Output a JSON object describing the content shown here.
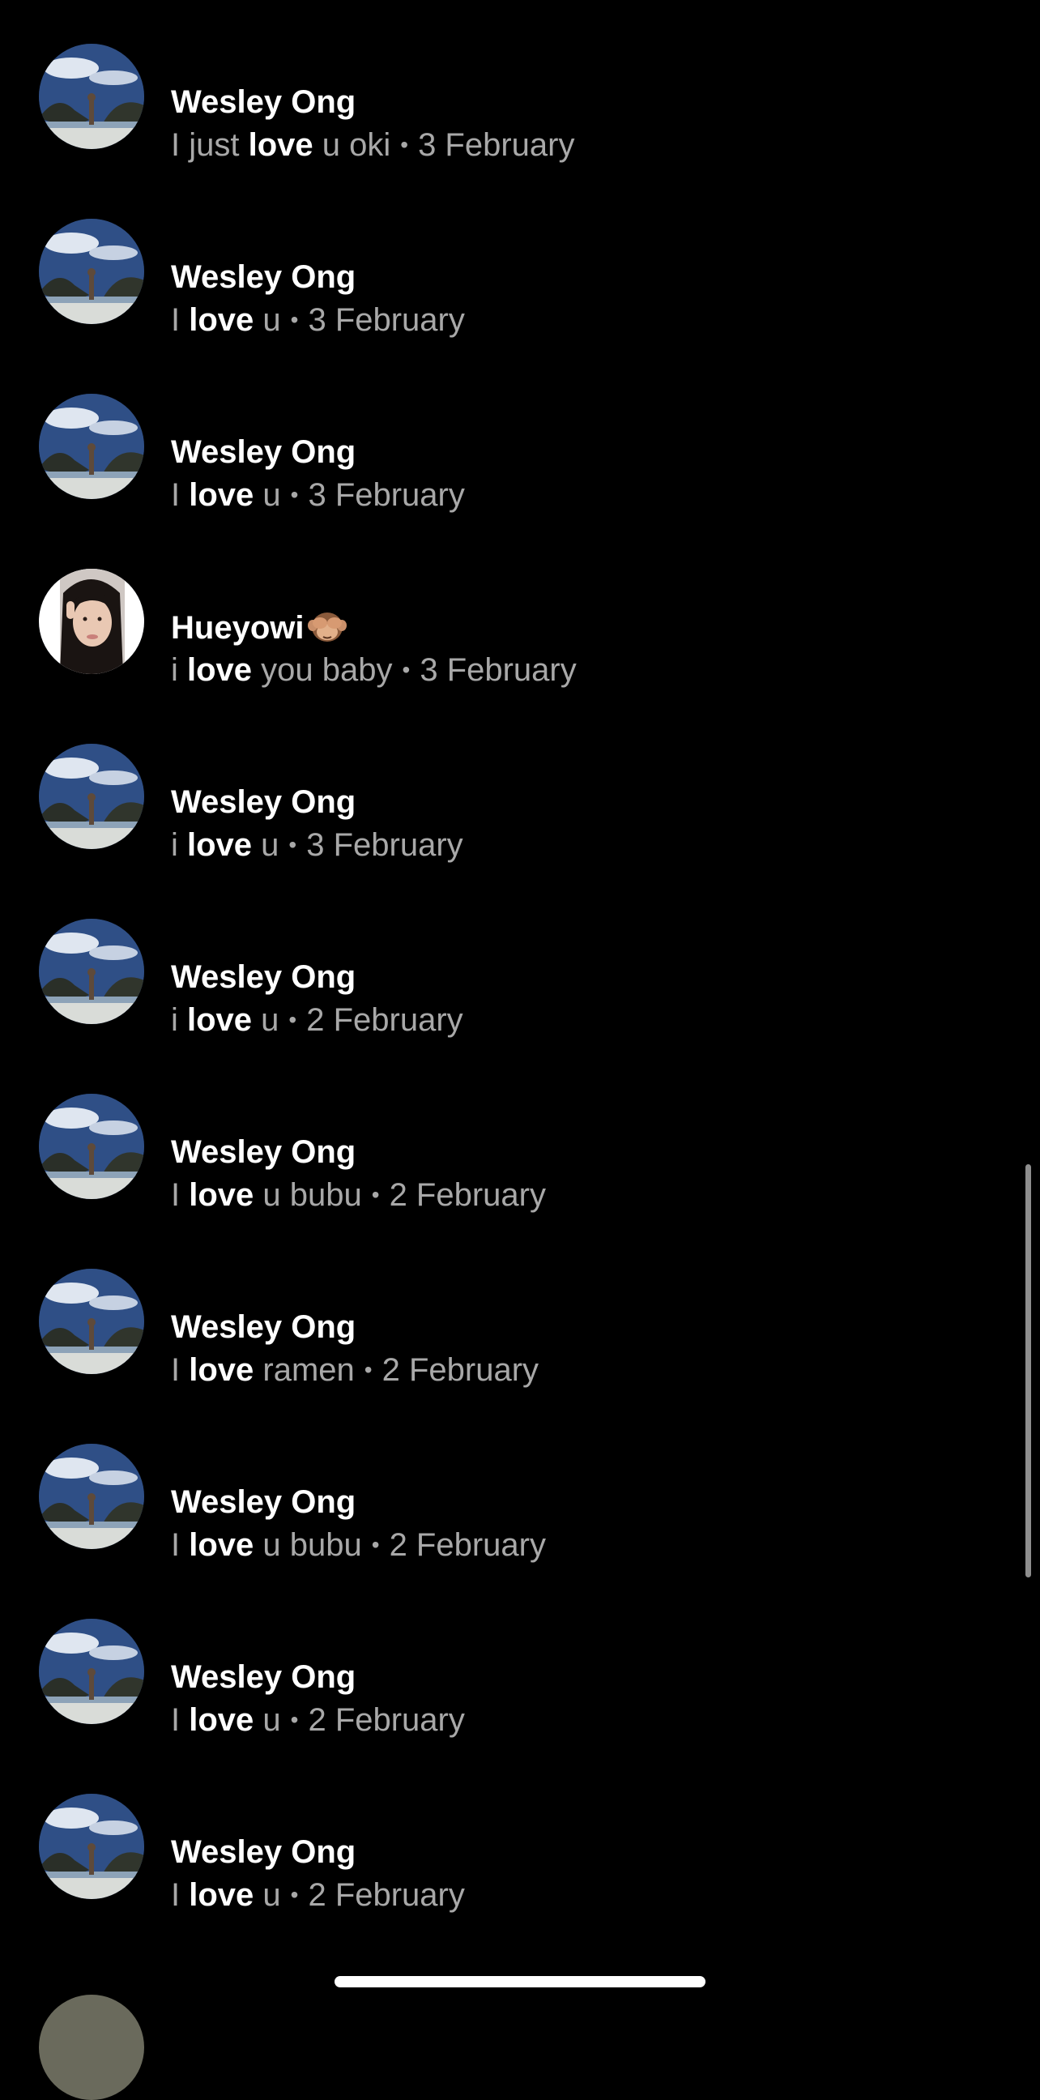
{
  "results": [
    {
      "name": "Wesley Ong",
      "avatar": "beach-photo-avatar",
      "before": "I just ",
      "match": "love",
      "after": " u oki",
      "separator": "•",
      "date": "3 February"
    },
    {
      "name": "Wesley Ong",
      "avatar": "beach-photo-avatar",
      "before": "I ",
      "match": "love",
      "after": " u",
      "separator": "•",
      "date": "3 February"
    },
    {
      "name": "Wesley Ong",
      "avatar": "beach-photo-avatar",
      "before": "I ",
      "match": "love",
      "after": " u",
      "separator": "•",
      "date": "3 February"
    },
    {
      "name": "Hueyowi",
      "name_emoji": "🙈",
      "avatar": "selfie-photo-avatar",
      "before": "i ",
      "match": "love",
      "after": " you baby",
      "separator": "•",
      "date": "3 February"
    },
    {
      "name": "Wesley Ong",
      "avatar": "beach-photo-avatar",
      "before": "i ",
      "match": "love",
      "after": " u",
      "separator": "•",
      "date": "3 February"
    },
    {
      "name": "Wesley Ong",
      "avatar": "beach-photo-avatar",
      "before": "i ",
      "match": "love",
      "after": " u",
      "separator": "•",
      "date": "2 February"
    },
    {
      "name": "Wesley Ong",
      "avatar": "beach-photo-avatar",
      "before": "I ",
      "match": "love",
      "after": " u bubu",
      "separator": "•",
      "date": "2 February"
    },
    {
      "name": "Wesley Ong",
      "avatar": "beach-photo-avatar",
      "before": "I ",
      "match": "love",
      "after": " ramen",
      "separator": "•",
      "date": "2 February"
    },
    {
      "name": "Wesley Ong",
      "avatar": "beach-photo-avatar",
      "before": "I ",
      "match": "love",
      "after": " u bubu",
      "separator": "•",
      "date": "2 February"
    },
    {
      "name": "Wesley Ong",
      "avatar": "beach-photo-avatar",
      "before": "I ",
      "match": "love",
      "after": " u",
      "separator": "•",
      "date": "2 February"
    },
    {
      "name": "Wesley Ong",
      "avatar": "beach-photo-avatar",
      "before": "I ",
      "match": "love",
      "after": " u",
      "separator": "•",
      "date": "2 February"
    }
  ],
  "colors": {
    "background": "#000000",
    "name_text": "#ffffff",
    "snippet_text": "#a8a8a8",
    "highlight_text": "#ffffff"
  }
}
